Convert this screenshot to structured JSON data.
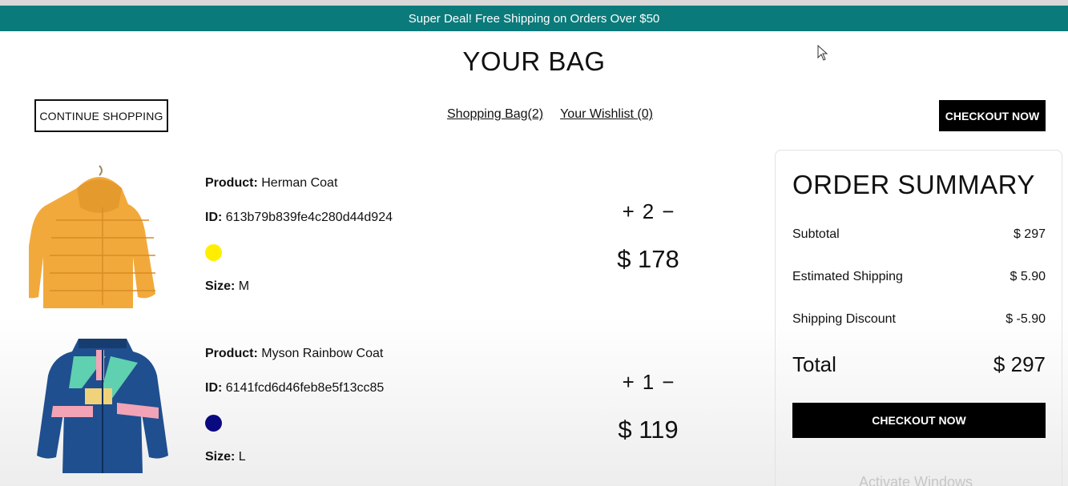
{
  "announcement": {
    "text": "Super Deal! Free Shipping on Orders Over $50"
  },
  "page": {
    "title": "YOUR BAG"
  },
  "toolbar": {
    "continue_label": "CONTINUE SHOPPING",
    "bag_link": "Shopping Bag(2)",
    "wishlist_link": "Your Wishlist (0)",
    "checkout_label": "CHECKOUT NOW"
  },
  "labels": {
    "product": "Product:",
    "id": "ID:",
    "size": "Size:"
  },
  "products": [
    {
      "name": "Herman Coat",
      "id": "613b79b839fe4c280d44d924",
      "color": "#ffee00",
      "size": "M",
      "quantity": "2",
      "price": "$ 178",
      "plus": "+",
      "minus": "−",
      "image": "yellow-puffer-jacket"
    },
    {
      "name": "Myson Rainbow Coat",
      "id": "6141fcd6d46feb8e5f13cc85",
      "color": "#0a0a80",
      "size": "L",
      "quantity": "1",
      "price": "$ 119",
      "plus": "+",
      "minus": "−",
      "image": "blue-rainbow-jacket"
    }
  ],
  "summary": {
    "title": "ORDER SUMMARY",
    "subtotal_label": "Subtotal",
    "subtotal_value": "$ 297",
    "shipping_label": "Estimated Shipping",
    "shipping_value": "$ 5.90",
    "discount_label": "Shipping Discount",
    "discount_value": "$ -5.90",
    "total_label": "Total",
    "total_value": "$ 297",
    "checkout_label": "CHECKOUT NOW"
  },
  "watermark": "Activate Windows",
  "colors": {
    "accent": "#0b7a7a",
    "button": "#000000"
  }
}
